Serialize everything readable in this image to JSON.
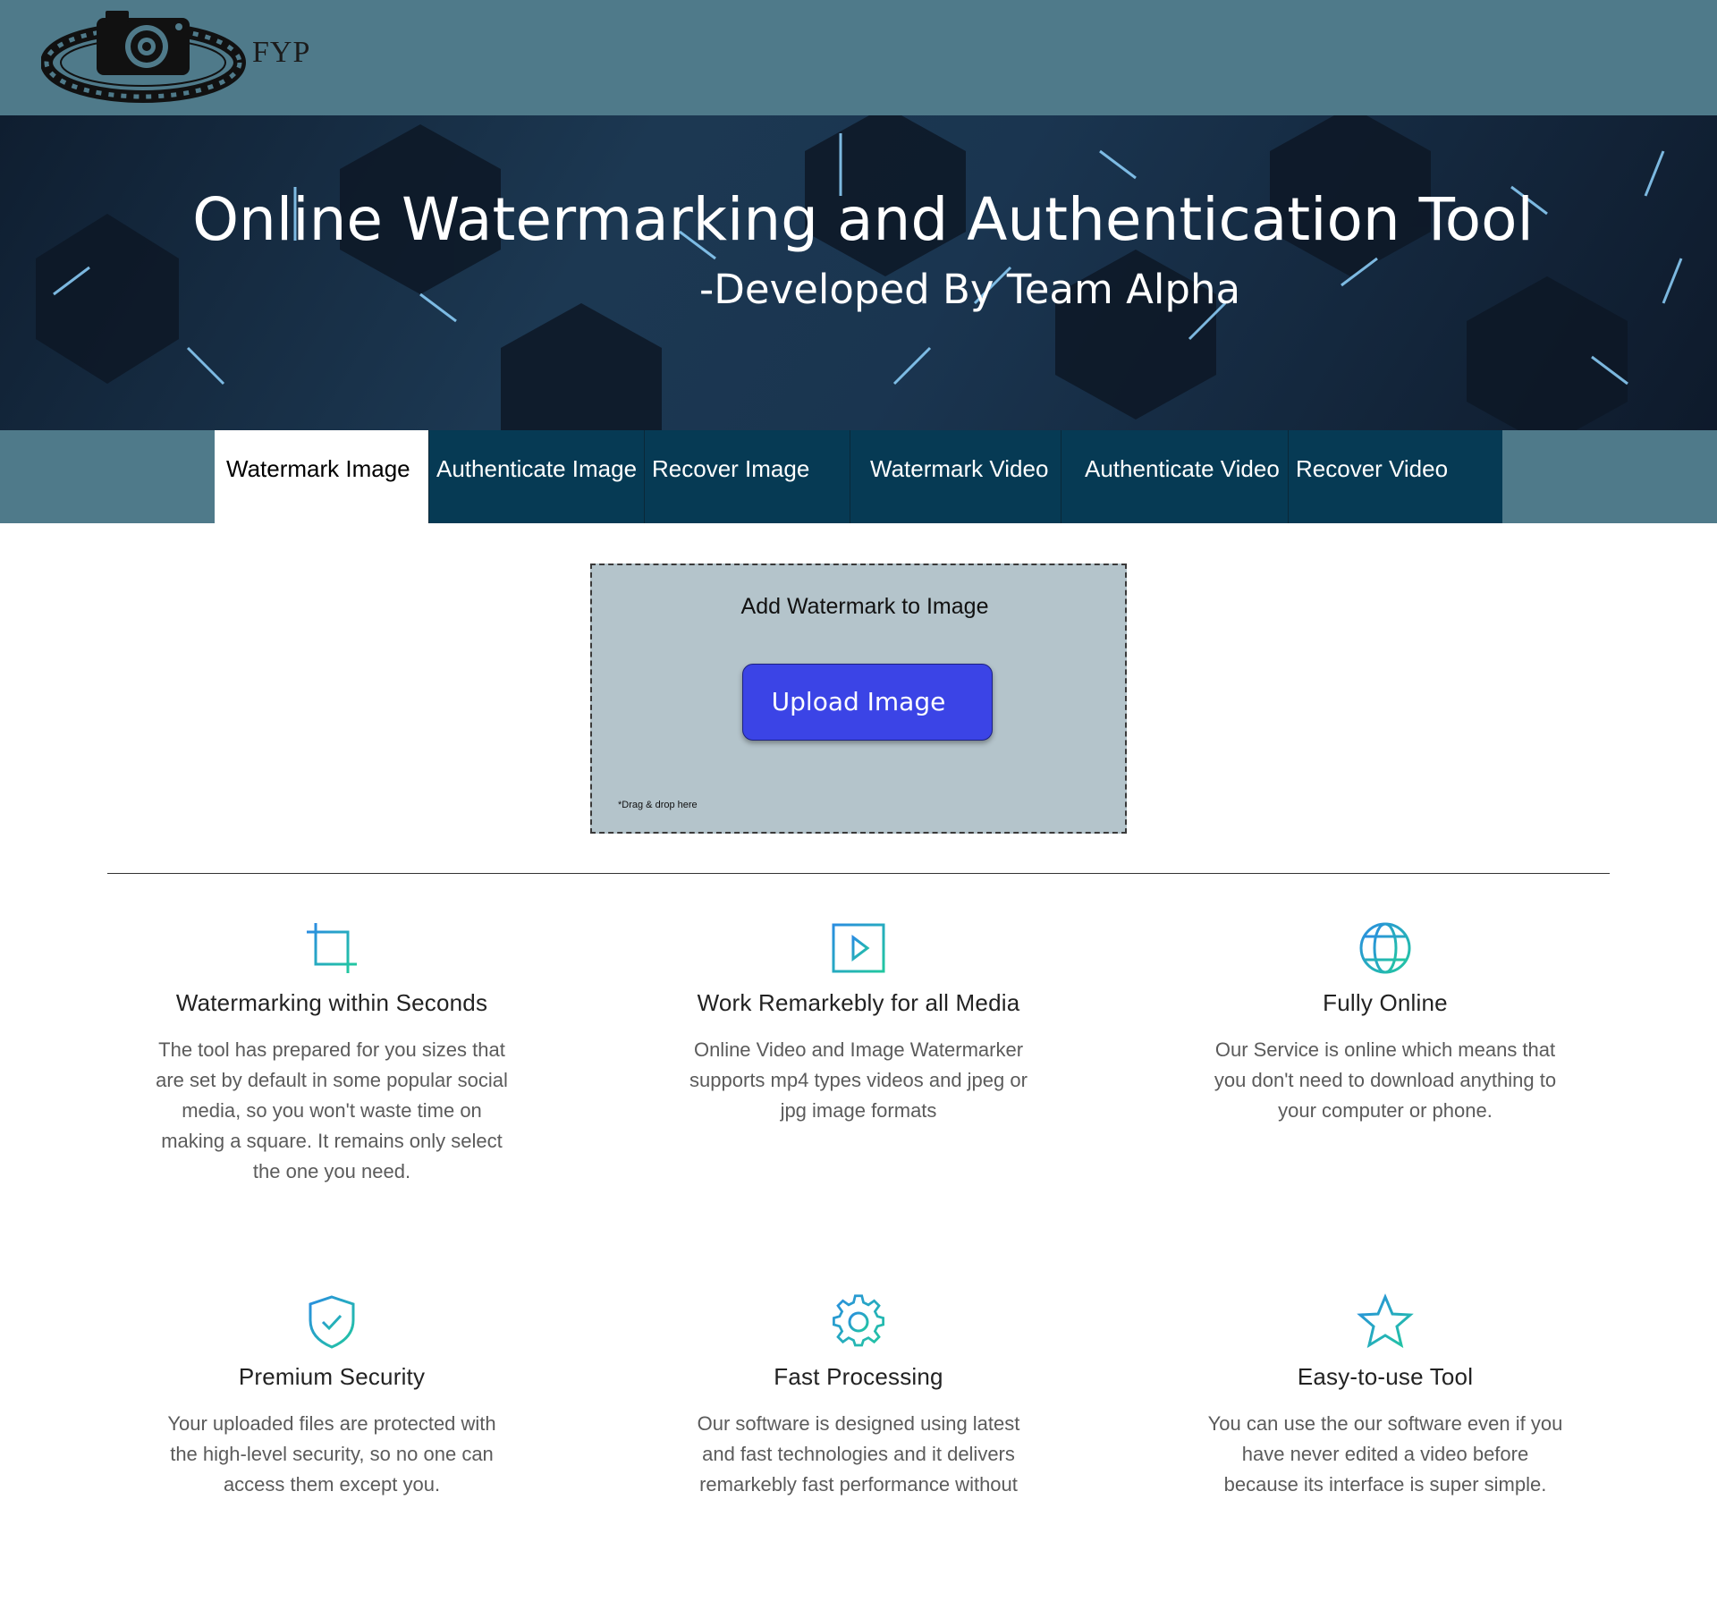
{
  "brand": {
    "name": "FYP"
  },
  "hero": {
    "title": "Online Watermarking and Authentication Tool",
    "subtitle": "-Developed By Team Alpha"
  },
  "tabs": [
    {
      "label": "Watermark Image",
      "active": true
    },
    {
      "label": "Authenticate Image",
      "active": false
    },
    {
      "label": "Recover Image",
      "active": false
    },
    {
      "label": "Watermark Video",
      "active": false
    },
    {
      "label": "Authenticate Video",
      "active": false
    },
    {
      "label": "Recover Video",
      "active": false
    }
  ],
  "upload": {
    "title": "Add Watermark to Image",
    "button_label": "Upload Image",
    "hint": "*Drag & drop here"
  },
  "features": [
    {
      "icon": "crop-icon",
      "title": "Watermarking within Seconds",
      "text": "The tool has prepared for you sizes that are set by default in some popular social media, so you won't waste time on making a square. It remains only select the one you need."
    },
    {
      "icon": "video-play-icon",
      "title": "Work Remarkebly for all Media",
      "text": "Online Video and Image Watermarker supports mp4 types videos and jpeg or jpg image formats"
    },
    {
      "icon": "globe-icon",
      "title": "Fully Online",
      "text": "Our Service is online which means that you don't need to download anything to your computer or phone."
    },
    {
      "icon": "shield-check-icon",
      "title": "Premium Security",
      "text": "Your uploaded files are protected with the high-level security, so no one can access them except you."
    },
    {
      "icon": "gear-icon",
      "title": "Fast Processing",
      "text": "Our software is designed using latest and fast technologies and it delivers remarkebly fast performance without"
    },
    {
      "icon": "star-icon",
      "title": "Easy-to-use Tool",
      "text": "You can use the our software even if you have never edited a video before because its interface is super simple."
    }
  ],
  "colors": {
    "header_bg": "#4f7a8a",
    "tab_bg": "#063a54",
    "upload_bg": "#b4c4cb",
    "button_bg": "#3b44e6",
    "icon_gradient_start": "#2a8de0",
    "icon_gradient_end": "#22c7a0"
  }
}
